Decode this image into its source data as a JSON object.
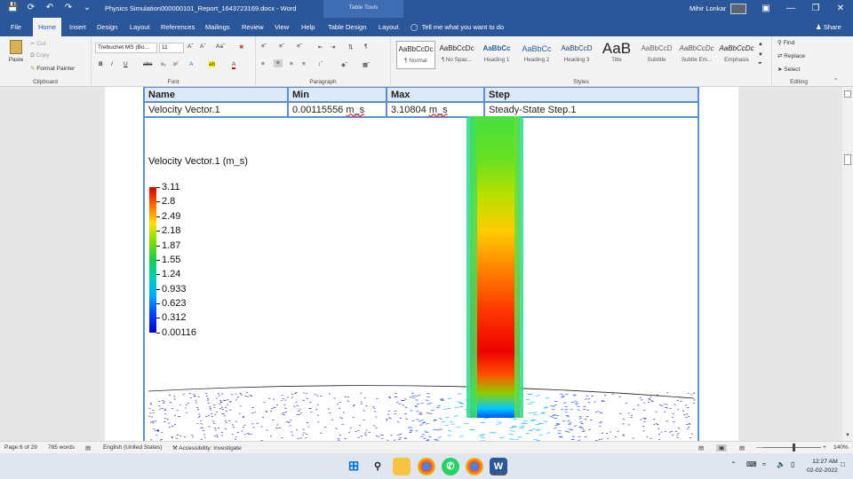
{
  "titlebar": {
    "doc_title": "Physics Simulation000000101_Report_1643723169.docx  -  Word",
    "context_tab": "Table Tools",
    "user": "Mihir Lonkar",
    "save_icon": "save-icon",
    "undo_icon": "undo-icon",
    "redo_icon": "redo-icon",
    "customize_icon": "customize-qat-icon"
  },
  "tabs": [
    "File",
    "Home",
    "Insert",
    "Design",
    "Layout",
    "References",
    "Mailings",
    "Review",
    "View",
    "Help",
    "Table Design",
    "Layout"
  ],
  "tell_me": "Tell me what you want to do",
  "share": "Share",
  "ribbon": {
    "clipboard": {
      "paste": "Paste",
      "cut": "Cut",
      "copy": "Copy",
      "format_painter": "Format Painter",
      "label": "Clipboard"
    },
    "font": {
      "family": "Trebuchet MS (Bo…",
      "size": "11",
      "label": "Font"
    },
    "paragraph": {
      "label": "Paragraph"
    },
    "styles": {
      "label": "Styles",
      "items": [
        {
          "preview": "AaBbCcDc",
          "name": "¶ Normal"
        },
        {
          "preview": "AaBbCcDc",
          "name": "¶ No Spac..."
        },
        {
          "preview": "AaBbCc",
          "name": "Heading 1"
        },
        {
          "preview": "AaBbCc",
          "name": "Heading 2"
        },
        {
          "preview": "AaBbCcD",
          "name": "Heading 3"
        },
        {
          "preview": "AaB",
          "name": "Title"
        },
        {
          "preview": "AaBbCcD",
          "name": "Subtitle"
        },
        {
          "preview": "AaBbCcDc",
          "name": "Subtle Em..."
        },
        {
          "preview": "AaBbCcDc",
          "name": "Emphasis"
        }
      ]
    },
    "editing": {
      "find": "Find",
      "replace": "Replace",
      "select": "Select",
      "label": "Editing"
    }
  },
  "table": {
    "headers": [
      "Name",
      "Min",
      "Max",
      "Step"
    ],
    "row": {
      "name": "Velocity Vector.1",
      "min_value": "0.00115556",
      "min_unit": "m_s",
      "max_value": "3.10804",
      "max_unit": "m_s",
      "step": "Steady-State Step.1"
    }
  },
  "visualization": {
    "legend_title": "Velocity Vector.1 (m_s)",
    "legend_ticks": [
      "3.11",
      "2.8",
      "2.49",
      "2.18",
      "1.87",
      "1.55",
      "1.24",
      "0.933",
      "0.623",
      "0.312",
      "0.00116"
    ],
    "colormap": [
      "#d40000",
      "#ff6a00",
      "#ffe000",
      "#79e000",
      "#10d050",
      "#00d0b8",
      "#00a8ff",
      "#0040ff",
      "#0000d0"
    ]
  },
  "statusbar": {
    "page": "Page 6 of 29",
    "words": "785 words",
    "language": "English (United States)",
    "accessibility": "Accessibility: Investigate",
    "zoom": "140%"
  },
  "taskbar": {
    "time": "12:27 AM",
    "date": "02-02-2022"
  }
}
